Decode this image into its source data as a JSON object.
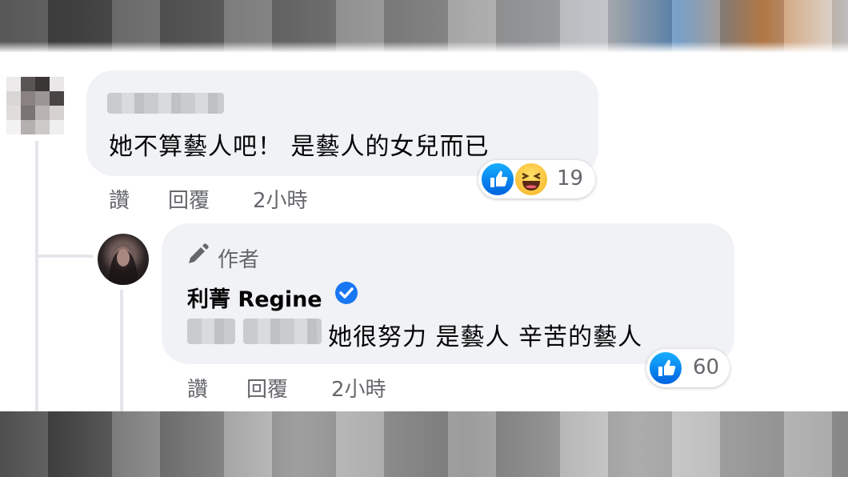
{
  "comment1": {
    "text": "她不算藝人吧！ 是藝人的女兒而已",
    "reaction_count": "19",
    "actions": {
      "like": "讚",
      "reply": "回覆",
      "time": "2小時"
    }
  },
  "comment2": {
    "author_badge": "作者",
    "author_name": "利菁 Regine",
    "text": "她很努力 是藝人 辛苦的藝人",
    "reaction_count": "60",
    "actions": {
      "like": "讚",
      "reply": "回覆",
      "time": "2小時"
    }
  },
  "colors": {
    "bubble": "#f0f2f5",
    "meta_text": "#65676b",
    "like_blue": "#1877f2"
  },
  "icons": {
    "like": "like-icon",
    "haha": "haha-icon",
    "author": "pencil-icon",
    "verified": "verified-badge-icon"
  }
}
